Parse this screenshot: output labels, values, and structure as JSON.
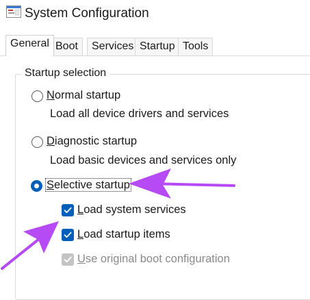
{
  "window": {
    "title": "System Configuration",
    "icon": "msconfig-window-icon"
  },
  "tabs": [
    {
      "label": "General",
      "active": true
    },
    {
      "label": "Boot",
      "active": false
    },
    {
      "label": "Services",
      "active": false
    },
    {
      "label": "Startup",
      "active": false
    },
    {
      "label": "Tools",
      "active": false
    }
  ],
  "startup_selection": {
    "group_label": "Startup selection",
    "normal": {
      "label": "Normal startup",
      "hotkey": "N",
      "rest": "ormal startup",
      "description": "Load all device drivers and services",
      "selected": false
    },
    "diagnostic": {
      "label": "Diagnostic startup",
      "hotkey": "D",
      "rest": "iagnostic startup",
      "description": "Load basic devices and services only",
      "selected": false
    },
    "selective": {
      "label": "Selective startup",
      "hotkey": "S",
      "rest": "elective startup",
      "selected": true,
      "options": {
        "load_system_services": {
          "label": "Load system services",
          "hotkey": "L",
          "rest": "oad system services",
          "checked": true,
          "enabled": true
        },
        "load_startup_items": {
          "label": "Load startup items",
          "hotkey": "L",
          "rest": "oad startup items",
          "checked": true,
          "enabled": true
        },
        "use_original_boot": {
          "label": "Use original boot configuration",
          "hotkey": "U",
          "rest": "se original boot configuration",
          "checked": true,
          "enabled": false
        }
      }
    }
  },
  "colors": {
    "accent": "#005fb8",
    "annotation_arrow": "#b64bf5",
    "disabled": "#c4c4c4"
  }
}
